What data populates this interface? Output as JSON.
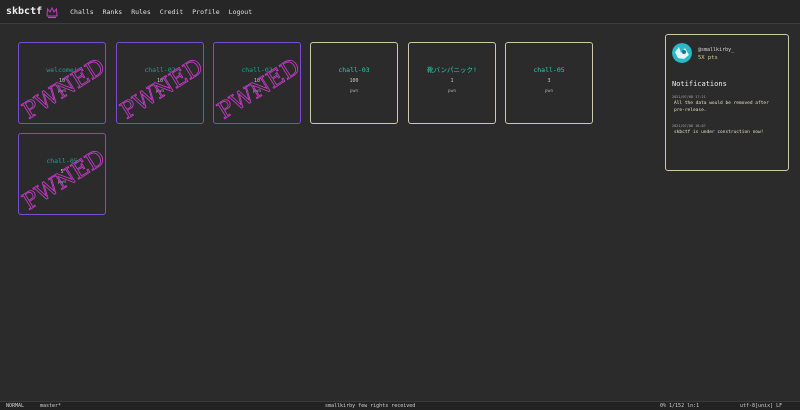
{
  "nav": {
    "brand": "skbctf",
    "logo_icon": "cat-face-icon",
    "links": [
      "Challs",
      "Ranks",
      "Rules",
      "Credit",
      "Profile",
      "Logout"
    ]
  },
  "pwned_stamp": "PWNED",
  "challenges": [
    {
      "name": "welcome!",
      "points": "10",
      "category": "pwn",
      "solved": true
    },
    {
      "name": "chall-02",
      "points": "10",
      "category": "pwn",
      "solved": true
    },
    {
      "name": "chall-02",
      "points": "10",
      "category": "pwn",
      "solved": true
    },
    {
      "name": "chall-03",
      "points": "100",
      "category": "pwn",
      "solved": false
    },
    {
      "name": "靴バンパニック!",
      "points": "1",
      "category": "pwn",
      "solved": false
    },
    {
      "name": "chall-05",
      "points": "3",
      "category": "pwn",
      "solved": false
    },
    {
      "name": "chall-05",
      "points": "5",
      "category": "pwn",
      "solved": true
    }
  ],
  "profile": {
    "username": "@smallkirby_",
    "points": "5X pts",
    "avatar_icon": "avatar-icon"
  },
  "notifications": {
    "title": "Notifications",
    "items": [
      {
        "date": "2021/07/08 17:21",
        "text": "All the data would be removed after pre-release."
      },
      {
        "date": "2021/07/08 18:07",
        "text": "skbctf is under construction now!"
      }
    ]
  },
  "statusbar": {
    "mode": "NORMAL",
    "branch": "master*",
    "message": "smallkirby few rights received",
    "position": "0% 1/152 ln:1",
    "encoding": "utf-8[unix] LF"
  },
  "colors": {
    "solved_border": "#7d4cd6",
    "unsolved_border": "#cfc9a6",
    "challenge_name": "#25d0b0",
    "pwned_stamp": "#c23bc4",
    "points_text": "#d8cf8a"
  }
}
